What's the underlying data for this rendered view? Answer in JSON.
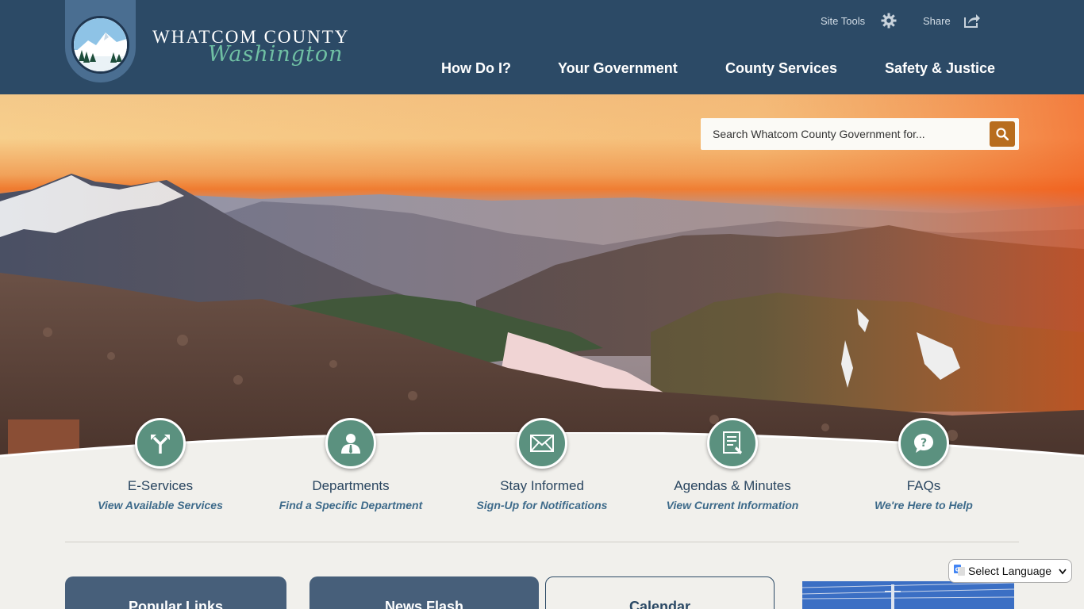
{
  "brand": {
    "line1": "WHATCOM COUNTY",
    "line2": "Washington"
  },
  "utility": {
    "site_tools": "Site Tools",
    "share": "Share"
  },
  "nav": [
    {
      "label": "How Do I?"
    },
    {
      "label": "Your Government"
    },
    {
      "label": "County Services"
    },
    {
      "label": "Safety & Justice"
    }
  ],
  "search": {
    "placeholder": "Search Whatcom County Government for..."
  },
  "quick_links": [
    {
      "title": "E-Services",
      "subtitle": "View Available Services",
      "icon": "signpost-arrows-icon"
    },
    {
      "title": "Departments",
      "subtitle": "Find a Specific Department",
      "icon": "person-icon"
    },
    {
      "title": "Stay Informed",
      "subtitle": "Sign-Up for Notifications",
      "icon": "envelope-icon"
    },
    {
      "title": "Agendas & Minutes",
      "subtitle": "View Current Information",
      "icon": "document-icon"
    },
    {
      "title": "FAQs",
      "subtitle": "We're Here to Help",
      "icon": "question-bubble-icon"
    }
  ],
  "cards": [
    {
      "title": "Popular Links"
    },
    {
      "title": "News Flash"
    },
    {
      "title": "Calendar"
    }
  ],
  "language": {
    "label": "Select Language"
  },
  "colors": {
    "header": "#2c4a66",
    "accent_green": "#5b917f",
    "search_button": "#b86d1e",
    "card": "#475f7a"
  }
}
